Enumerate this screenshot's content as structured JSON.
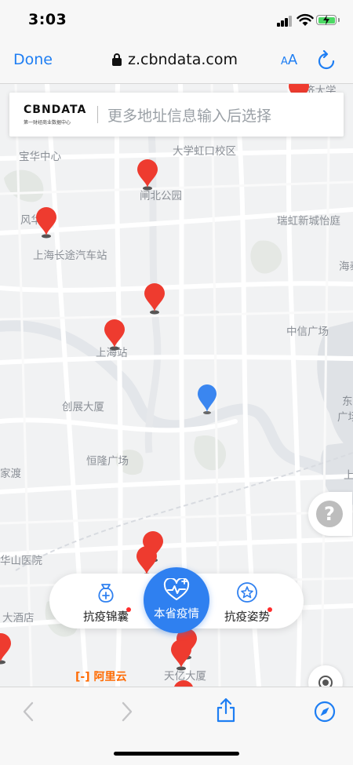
{
  "status_bar": {
    "time": "3:03"
  },
  "browser": {
    "done_label": "Done",
    "url": "z.cbndata.com",
    "text_size_label_big": "A",
    "text_size_label_small": "A"
  },
  "search": {
    "logo_text": "CBNDATA",
    "logo_subtext": "第一财经商业数据中心",
    "placeholder": "更多地址信息输入后选择"
  },
  "map": {
    "labels": [
      "济大学",
      "大学虹口校区",
      "宝华中心",
      "闸北公园",
      "风华学",
      "瑞虹新城怡庭",
      "上海长途汽车站",
      "海泰",
      "中信广场",
      "上海站",
      "东",
      "广场",
      "创展大厦",
      "恒隆广场",
      "家渡",
      "上",
      "华山医院",
      "大酒店",
      "天亿大厦"
    ]
  },
  "nav": {
    "left_label": "抗疫锦囊",
    "center_label": "本省疫情",
    "right_label": "抗疫姿势"
  },
  "help_label": "?",
  "aliyun_label": "阿里云",
  "colors": {
    "accent": "#2f80f0",
    "pin_red": "#ee3b2f",
    "pin_blue": "#3a86f0",
    "badge": "#ff2d2d"
  }
}
